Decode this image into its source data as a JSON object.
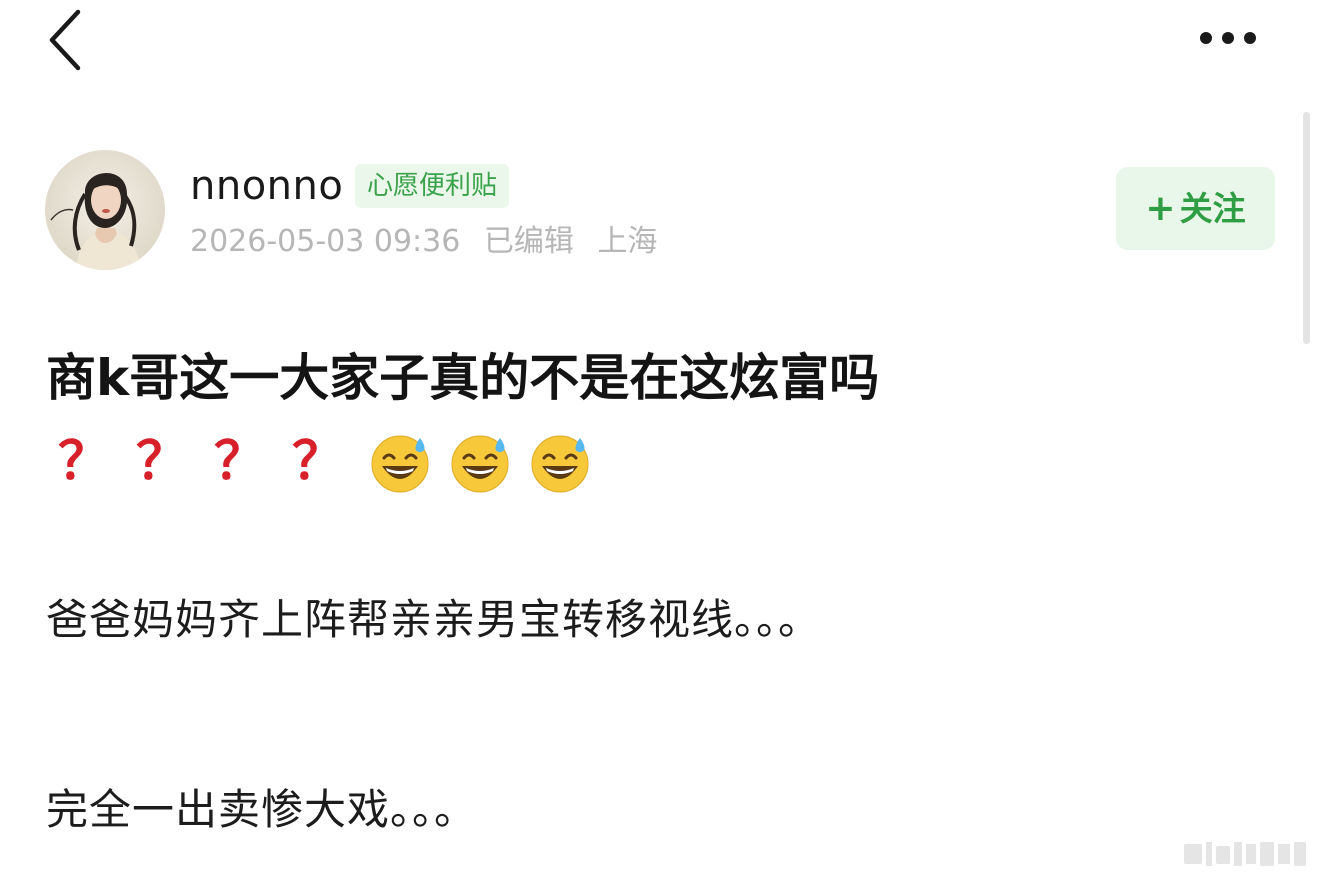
{
  "nav": {
    "back_icon": "chevron-left-icon",
    "more_icon": "more-dots-icon"
  },
  "author": {
    "name": "nnonno",
    "badge": "心愿便利贴",
    "date": "2026-05-03 09:36",
    "edited": "已编辑",
    "location": "上海",
    "follow_label": "关注",
    "follow_icon": "plus-icon"
  },
  "post": {
    "title": "商k哥这一大家子真的不是在这炫富吗",
    "reactions": {
      "question_mark_count": 4,
      "question_mark_glyph": "？",
      "sweat_smile_count": 3
    },
    "paragraphs": [
      "爸爸妈妈齐上阵帮亲亲男宝转移视线。。。",
      "完全一出卖惨大戏。。。"
    ]
  },
  "colors": {
    "accent_green": "#2f9d43",
    "badge_bg": "#eaf7ea",
    "meta_gray": "#b6b6b6",
    "question_red": "#d7202a"
  }
}
